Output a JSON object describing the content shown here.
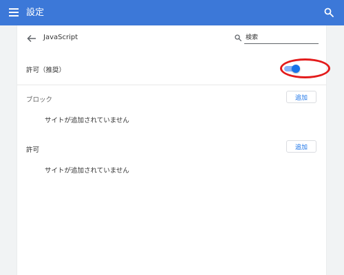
{
  "app": {
    "title": "設定"
  },
  "subheader": {
    "title": "JavaScript",
    "search_placeholder": "検索"
  },
  "main_setting": {
    "label": "許可（推奨）",
    "toggle_on": true
  },
  "block_section": {
    "title": "ブロック",
    "add_label": "追加",
    "empty_text": "サイトが追加されていません"
  },
  "allow_section": {
    "title": "許可",
    "add_label": "追加",
    "empty_text": "サイトが追加されていません"
  },
  "colors": {
    "app_bar": "#3c78d8",
    "accent": "#1a73e8",
    "highlight_ring": "#e31b1b"
  }
}
